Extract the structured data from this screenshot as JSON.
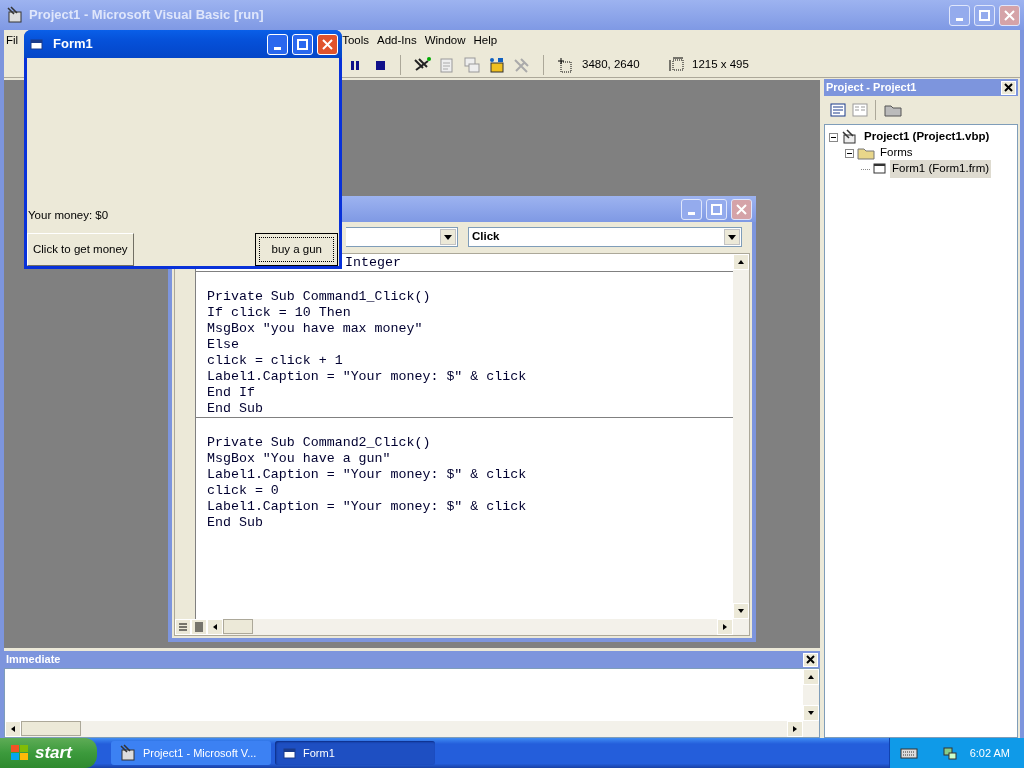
{
  "main_window": {
    "title": "Project1 - Microsoft Visual Basic [run]",
    "active": false
  },
  "menu": [
    "Fil",
    "Tools",
    "Add-Ins",
    "Window",
    "Help"
  ],
  "toolbar": {
    "position": "3480, 2640",
    "size": "1215 x 495"
  },
  "form_window": {
    "title": "Form1",
    "active": true,
    "label": "Your money: $0",
    "buttons": [
      {
        "label": "Click to get money",
        "focused": false
      },
      {
        "label": "buy a gun",
        "focused": true
      }
    ]
  },
  "code_window": {
    "active": false,
    "procedure_combo": "Click",
    "sections": [
      [
        "Integer"
      ],
      [
        "Private Sub Command1_Click()",
        "If click = 10 Then",
        "MsgBox \"you have max money\"",
        "Else",
        "click = click + 1",
        "Label1.Caption = \"Your money: $\" & click",
        "End If",
        "End Sub"
      ],
      [
        "Private Sub Command2_Click()",
        "MsgBox \"You have a gun\"",
        "Label1.Caption = \"Your money: $\" & click",
        "click = 0",
        "Label1.Caption = \"Your money: $\" & click",
        "End Sub"
      ]
    ]
  },
  "project_panel": {
    "title": "Project - Project1",
    "tree": [
      {
        "label": "Project1 (Project1.vbp)",
        "selected": false,
        "expanded": true,
        "children": [
          {
            "label": "Forms",
            "selected": false,
            "expanded": true,
            "children": [
              {
                "label": "Form1 (Form1.frm)",
                "selected": true
              }
            ]
          }
        ]
      }
    ]
  },
  "immediate": {
    "title": "Immediate"
  },
  "taskbar": {
    "start": "start",
    "tasks": [
      {
        "label": "Project1 - Microsoft V...",
        "selected": false
      },
      {
        "label": "Form1",
        "selected": true
      }
    ],
    "clock": "6:02 AM"
  }
}
